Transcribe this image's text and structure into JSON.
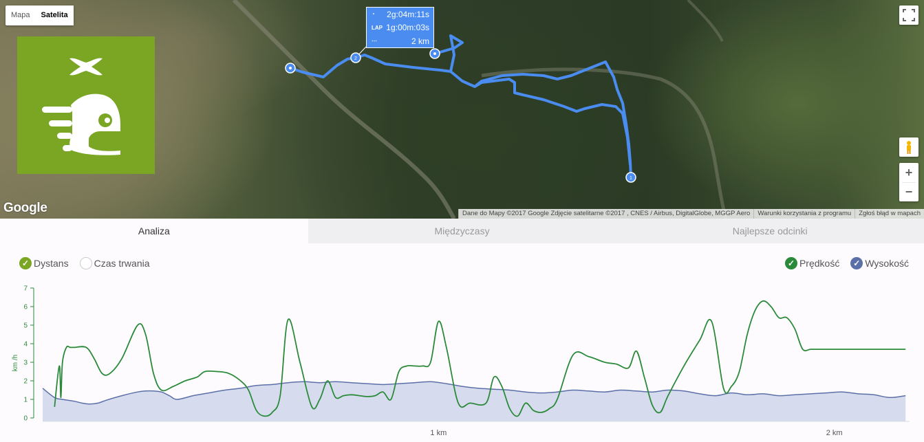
{
  "map": {
    "type_buttons": [
      "Mapa",
      "Satelita"
    ],
    "active_type": "Satelita",
    "google_logo": "Google",
    "attribution": [
      "Dane do Mapy ©2017 Google Zdjęcie satelitarne ©2017 , CNES / Airbus, DigitalGlobe, MGGP Aero",
      "Warunki korzystania z programu",
      "Zgłoś błąd w mapach"
    ],
    "zoom_in": "+",
    "zoom_out": "−",
    "route_color": "#4a8cf0",
    "markers": [
      "1",
      "2"
    ],
    "info_bubble": {
      "total_time": "2g:04m:11s",
      "lap_label": "LAP",
      "lap_time": "1g:00m:03s",
      "distance": "2 km"
    },
    "brand_color": "#7aa624"
  },
  "tabs": [
    {
      "label": "Analiza",
      "active": true
    },
    {
      "label": "Międzyczasy",
      "active": false
    },
    {
      "label": "Najlepsze odcinki",
      "active": false
    }
  ],
  "legend_left": [
    {
      "label": "Dystans",
      "checked": true,
      "color": "#7aa624"
    },
    {
      "label": "Czas trwania",
      "checked": false,
      "color": "#ffffff"
    }
  ],
  "legend_right": [
    {
      "label": "Prędkość",
      "checked": true,
      "color": "#2a8a3a"
    },
    {
      "label": "Wysokość",
      "checked": true,
      "color": "#5b6fa8"
    }
  ],
  "chart_data": {
    "type": "line",
    "ylabel": "km /h",
    "yticks": [
      "0",
      "1",
      "2",
      "3",
      "4",
      "5",
      "6",
      "7"
    ],
    "ylim": [
      0,
      7
    ],
    "xlim": [
      0,
      2.19
    ],
    "xticks": [
      {
        "value": 1,
        "label": "1 km"
      },
      {
        "value": 2,
        "label": "2 km"
      }
    ],
    "series": [
      {
        "name": "Prędkość",
        "color": "#2a8a3a",
        "x": [
          0.03,
          0.042,
          0.046,
          0.05,
          0.06,
          0.07,
          0.08,
          0.11,
          0.13,
          0.15,
          0.17,
          0.2,
          0.24,
          0.26,
          0.28,
          0.3,
          0.33,
          0.36,
          0.39,
          0.41,
          0.44,
          0.47,
          0.5,
          0.52,
          0.54,
          0.56,
          0.58,
          0.6,
          0.62,
          0.65,
          0.68,
          0.7,
          0.72,
          0.74,
          0.76,
          0.78,
          0.8,
          0.82,
          0.84,
          0.86,
          0.88,
          0.9,
          0.92,
          0.94,
          0.96,
          0.98,
          1.0,
          1.02,
          1.05,
          1.08,
          1.12,
          1.14,
          1.16,
          1.18,
          1.2,
          1.22,
          1.24,
          1.26,
          1.28,
          1.3,
          1.34,
          1.38,
          1.42,
          1.45,
          1.48,
          1.5,
          1.52,
          1.54,
          1.56,
          1.58,
          1.62,
          1.66,
          1.69,
          1.72,
          1.74,
          1.76,
          1.78,
          1.8,
          1.82,
          1.84,
          1.86,
          1.88,
          1.9,
          1.92,
          1.94,
          1.96,
          1.98,
          2.0,
          2.02,
          2.04,
          2.06,
          2.08,
          2.1,
          2.12,
          2.14,
          2.16,
          2.18
        ],
        "values": [
          0.6,
          2.8,
          1.1,
          3.0,
          3.8,
          3.8,
          3.8,
          3.8,
          3.2,
          2.4,
          2.4,
          3.2,
          5.0,
          4.5,
          2.4,
          1.5,
          1.7,
          2.0,
          2.2,
          2.5,
          2.5,
          2.4,
          2.0,
          1.5,
          0.4,
          0.1,
          0.3,
          1.2,
          5.3,
          3.0,
          0.6,
          1.0,
          2.0,
          1.1,
          1.2,
          1.25,
          1.2,
          1.15,
          1.2,
          1.4,
          1.0,
          2.5,
          2.8,
          2.8,
          2.8,
          3.0,
          5.2,
          3.8,
          0.8,
          0.8,
          0.8,
          2.2,
          1.7,
          0.5,
          0.1,
          0.8,
          0.4,
          0.3,
          0.5,
          1.0,
          3.4,
          3.3,
          3.0,
          2.9,
          2.7,
          3.6,
          2.2,
          0.7,
          0.3,
          1.2,
          2.8,
          4.2,
          5.2,
          1.6,
          1.7,
          2.5,
          4.5,
          5.8,
          6.3,
          6.0,
          5.4,
          5.4,
          4.8,
          3.7,
          3.7,
          3.7,
          3.7,
          3.7,
          3.7,
          3.7,
          3.7,
          3.7,
          3.7,
          3.7,
          3.7,
          3.7,
          3.7
        ]
      },
      {
        "name": "Wysokość",
        "color": "#5b6fa8",
        "x": [
          0.0,
          0.03,
          0.05,
          0.08,
          0.1,
          0.12,
          0.14,
          0.16,
          0.2,
          0.24,
          0.26,
          0.28,
          0.3,
          0.32,
          0.34,
          0.38,
          0.42,
          0.46,
          0.5,
          0.54,
          0.58,
          0.62,
          0.66,
          0.7,
          0.74,
          0.78,
          0.82,
          0.86,
          0.9,
          0.94,
          0.98,
          1.02,
          1.06,
          1.1,
          1.14,
          1.18,
          1.22,
          1.26,
          1.3,
          1.34,
          1.38,
          1.42,
          1.46,
          1.5,
          1.54,
          1.58,
          1.62,
          1.66,
          1.7,
          1.74,
          1.78,
          1.82,
          1.86,
          1.9,
          1.94,
          1.98,
          2.02,
          2.06,
          2.1,
          2.14,
          2.18
        ],
        "values": [
          1.6,
          1.1,
          1.0,
          0.9,
          0.8,
          0.75,
          0.8,
          0.95,
          1.2,
          1.4,
          1.45,
          1.45,
          1.4,
          1.2,
          1.0,
          1.2,
          1.35,
          1.5,
          1.6,
          1.75,
          1.8,
          1.9,
          1.95,
          1.9,
          1.95,
          1.9,
          1.85,
          1.8,
          1.85,
          1.9,
          1.95,
          1.85,
          1.7,
          1.6,
          1.55,
          1.5,
          1.4,
          1.35,
          1.4,
          1.5,
          1.45,
          1.4,
          1.5,
          1.45,
          1.4,
          1.5,
          1.45,
          1.3,
          1.2,
          1.35,
          1.25,
          1.3,
          1.2,
          1.25,
          1.3,
          1.35,
          1.4,
          1.3,
          1.25,
          1.1,
          1.2
        ]
      }
    ]
  }
}
